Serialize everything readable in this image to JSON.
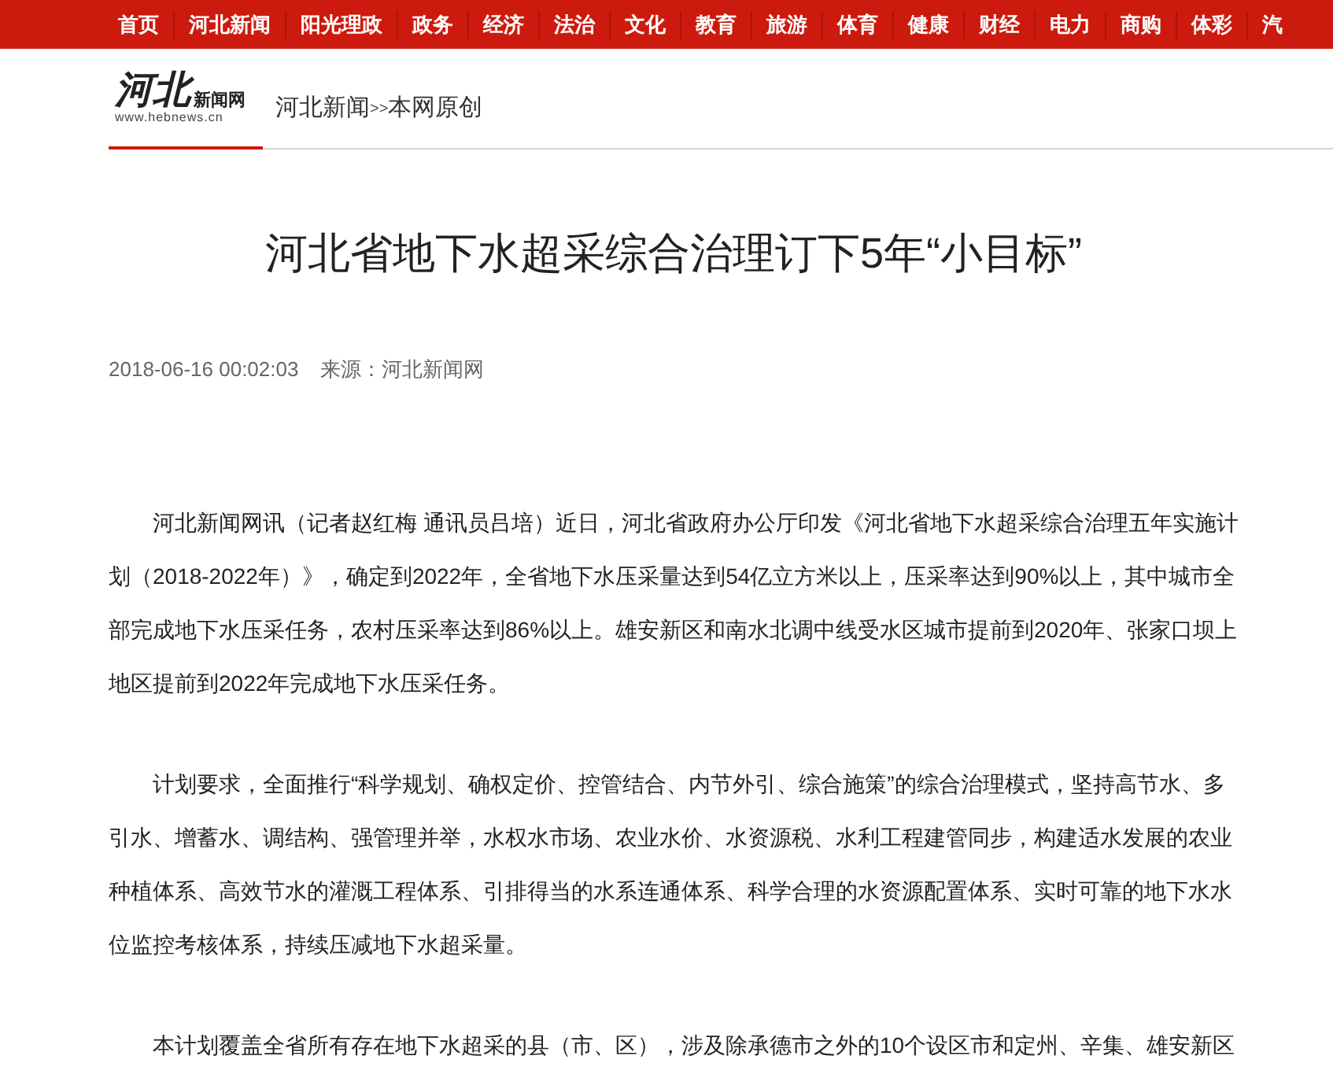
{
  "nav": [
    "首页",
    "河北新闻",
    "阳光理政",
    "政务",
    "经济",
    "法治",
    "文化",
    "教育",
    "旅游",
    "体育",
    "健康",
    "财经",
    "电力",
    "商购",
    "体彩",
    "汽"
  ],
  "logo": {
    "mark": "河北",
    "name": "新闻网",
    "url": "www.hebnews.cn"
  },
  "breadcrumb": [
    "河北新闻",
    ">>",
    "本网原创"
  ],
  "title": "河北省地下水超采综合治理订下5年“小目标”",
  "meta": {
    "time": "2018-06-16 00:02:03",
    "source": "来源：河北新闻网"
  },
  "paragraphs": [
    "河北新闻网讯（记者赵红梅 通讯员吕培）近日，河北省政府办公厅印发《河北省地下水超采综合治理五年实施计划（2018-2022年）》，确定到2022年，全省地下水压采量达到54亿立方米以上，压采率达到90%以上，其中城市全部完成地下水压采任务，农村压采率达到86%以上。雄安新区和南水北调中线受水区城市提前到2020年、张家口坝上地区提前到2022年完成地下水压采任务。",
    "计划要求，全面推行“科学规划、确权定价、控管结合、内节外引、综合施策”的综合治理模式，坚持高节水、多引水、增蓄水、调结构、强管理并举，水权水市场、农业水价、水资源税、水利工程建管同步，构建适水发展的农业种植体系、高效节水的灌溉工程体系、引排得当的水系连通体系、科学合理的水资源配置体系、实时可靠的地下水水位监控考核体系，持续压减地下水超采量。",
    "本计划覆盖全省所有存在地下水超采的县（市、区），涉及除承德市之外的10个设区市和定州、辛集、雄安新区"
  ]
}
